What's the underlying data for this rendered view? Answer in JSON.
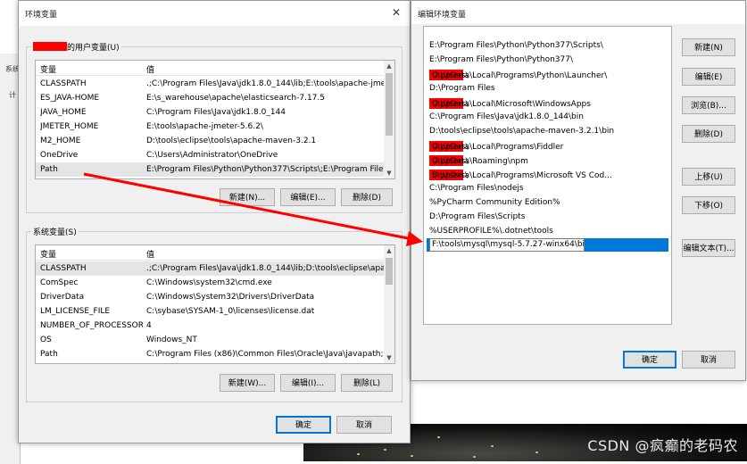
{
  "background": {
    "left_window_label": "系统",
    "left_window_label2": "计",
    "watermark": "CSDN @疯癫的老码农"
  },
  "env_window": {
    "title": "环境变量",
    "user_group_label": "的用户变量(U)",
    "columns": [
      "变量",
      "值"
    ],
    "user_vars": [
      {
        "name": "CLASSPATH",
        "value": ".;C:\\Program Files\\Java\\jdk1.8.0_144\\lib;E:\\tools\\apache-jmet..."
      },
      {
        "name": "ES_JAVA-HOME",
        "value": "E:\\s_warehouse\\apache\\elasticsearch-7.17.5"
      },
      {
        "name": "JAVA_HOME",
        "value": "C:\\Program Files\\Java\\jdk1.8.0_144"
      },
      {
        "name": "JMETER_HOME",
        "value": "E:\\tools\\apache-jmeter-5.6.2\\"
      },
      {
        "name": "M2_HOME",
        "value": "D:\\tools\\eclipse\\tools\\apache-maven-3.2.1"
      },
      {
        "name": "OneDrive",
        "value": "C:\\Users\\Administrator\\OneDrive"
      },
      {
        "name": "Path",
        "value": "E:\\Program Files\\Python\\Python377\\Scripts\\;E:\\Program Files\\..."
      }
    ],
    "user_buttons": {
      "new": "新建(N)...",
      "edit": "编辑(E)...",
      "delete": "删除(D)"
    },
    "system_group_label": "系统变量(S)",
    "system_vars": [
      {
        "name": "CLASSPATH",
        "value": ".;C:\\Program Files\\Java\\jdk1.8.0_144\\lib;D:\\tools\\eclipse\\apac..."
      },
      {
        "name": "ComSpec",
        "value": "C:\\Windows\\system32\\cmd.exe"
      },
      {
        "name": "DriverData",
        "value": "C:\\Windows\\System32\\Drivers\\DriverData"
      },
      {
        "name": "LM_LICENSE_FILE",
        "value": "C:\\sybase\\SYSAM-1_0\\licenses\\license.dat"
      },
      {
        "name": "NUMBER_OF_PROCESSORS",
        "value": "4"
      },
      {
        "name": "OS",
        "value": "Windows_NT"
      },
      {
        "name": "Path",
        "value": "C:\\Program Files (x86)\\Common Files\\Oracle\\Java\\javapath;C:..."
      }
    ],
    "system_buttons": {
      "new": "新建(W)...",
      "edit": "编辑(I)...",
      "delete": "删除(L)"
    },
    "ok": "确定",
    "cancel": "取消"
  },
  "edit_window": {
    "title": "编辑环境变量",
    "entries": [
      {
        "pre": "E:\\Program Files\\Python\\Python377\\Scripts\\",
        "redacted": false,
        "post": ""
      },
      {
        "pre": "E:\\Program Files\\Python\\Python377\\",
        "redacted": false,
        "post": ""
      },
      {
        "pre": "C:\\Users\\",
        "redacted": true,
        "post": "\\AppData\\Local\\Programs\\Python\\Launcher\\"
      },
      {
        "pre": "D:\\Program Files",
        "redacted": false,
        "post": ""
      },
      {
        "pre": "C:\\Users\\",
        "redacted": true,
        "post": "\\AppData\\Local\\Microsoft\\WindowsApps"
      },
      {
        "pre": "C:\\Program Files\\Java\\jdk1.8.0_144\\bin",
        "redacted": false,
        "post": ""
      },
      {
        "pre": "D:\\tools\\eclipse\\tools\\apache-maven-3.2.1\\bin",
        "redacted": false,
        "post": ""
      },
      {
        "pre": "C:\\Users\\",
        "redacted": true,
        "post": "\\AppData\\Local\\Programs\\Fiddler"
      },
      {
        "pre": "C:\\Users\\",
        "redacted": true,
        "post": "\\AppData\\Roaming\\npm"
      },
      {
        "pre": "E:\\Users\\",
        "redacted": true,
        "post": "\\AppData\\Local\\Programs\\Microsoft VS Cod..."
      },
      {
        "pre": "C:\\Program Files\\nodejs",
        "redacted": false,
        "post": ""
      },
      {
        "pre": "%PyCharm Community Edition%",
        "redacted": false,
        "post": ""
      },
      {
        "pre": "D:\\Program Files\\Scripts",
        "redacted": false,
        "post": ""
      },
      {
        "pre": "%USERPROFILE%\\.dotnet\\tools",
        "redacted": false,
        "post": ""
      }
    ],
    "editing_value": "F:\\tools\\mysql\\mysql-5.7.27-winx64\\bin",
    "buttons": {
      "new": "新建(N)",
      "edit": "编辑(E)",
      "browse": "浏览(B)...",
      "delete": "删除(D)",
      "move_up": "上移(U)",
      "move_down": "下移(O)",
      "edit_text": "编辑文本(T)..."
    },
    "ok": "确定",
    "cancel": "取消"
  },
  "colors": {
    "selection": "#0078d7",
    "annotation_arrow": "#ff0000",
    "redaction": "#ff0000"
  }
}
